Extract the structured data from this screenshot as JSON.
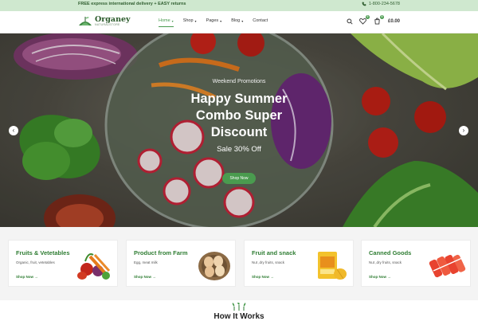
{
  "topbar": {
    "promo": "FREE express international delivery + EASY returns",
    "phone": "1-800-234-5678"
  },
  "logo": {
    "brand": "Organey",
    "tagline": "NATURALSTORE"
  },
  "nav": {
    "items": [
      {
        "label": "Home",
        "active": true
      },
      {
        "label": "Shop",
        "active": false
      },
      {
        "label": "Pages",
        "active": false
      },
      {
        "label": "Blog",
        "active": false
      },
      {
        "label": "Contact",
        "active": false
      }
    ]
  },
  "header": {
    "wishlist_count": "0",
    "cart_count": "0",
    "cart_total": "£0.00"
  },
  "hero": {
    "kicker": "Weekend Promotions",
    "title_lines": [
      "Happy Summer",
      "Combo Super",
      "Discount"
    ],
    "sale": "Sale 30% Off",
    "button": "Shop Now"
  },
  "categories": [
    {
      "title": "Fruits & Vetetables",
      "subtitle": "Organic, fruit, vetetables",
      "link": "Shop Now →"
    },
    {
      "title": "Product from Farm",
      "subtitle": "Egg, meat milk",
      "link": "Shop Now →"
    },
    {
      "title": "Fruit and snack",
      "subtitle": "Nut ,dry fruits, snack",
      "link": "Shop Now →"
    },
    {
      "title": "Canned Goods",
      "subtitle": "Nut ,dry fruits, snack",
      "link": "Shop Now →"
    }
  ],
  "how": {
    "title": "How It Works"
  },
  "colors": {
    "accent": "#4a9b4f",
    "topbar": "#cfe8cf",
    "section_bg": "#f4f4f4"
  },
  "icons": [
    "phone-icon",
    "search-icon",
    "heart-icon",
    "cart-icon",
    "chevron-left-icon",
    "chevron-right-icon",
    "chevron-down-icon",
    "sprout-icon"
  ]
}
